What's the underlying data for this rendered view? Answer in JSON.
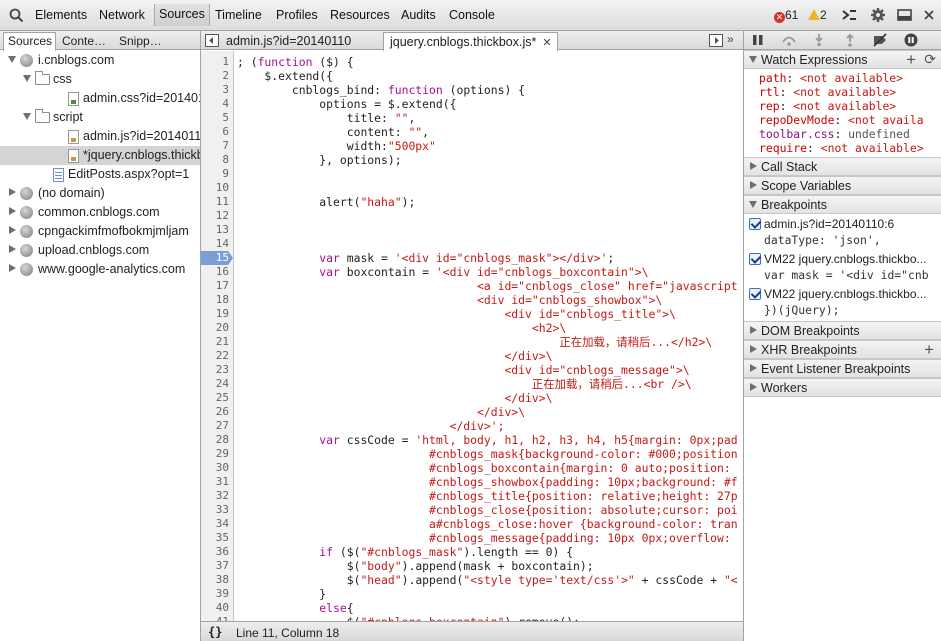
{
  "toolbar": {
    "panels": [
      "Elements",
      "Network",
      "Sources",
      "Timeline",
      "Profiles",
      "Resources",
      "Audits",
      "Console"
    ],
    "active_panel": "Sources",
    "error_count": "61",
    "warning_count": "2"
  },
  "navigator": {
    "tabs": [
      "Sources",
      "Conte…",
      "Snipp…"
    ],
    "tree": [
      {
        "label": "i.cnblogs.com",
        "level": 0,
        "type": "domain",
        "expanded": true
      },
      {
        "label": "css",
        "level": 1,
        "type": "folder",
        "expanded": true
      },
      {
        "label": "admin.css?id=20140110",
        "level": 2,
        "type": "css"
      },
      {
        "label": "script",
        "level": 1,
        "type": "folder",
        "expanded": true
      },
      {
        "label": "admin.js?id=20140110",
        "level": 2,
        "type": "js"
      },
      {
        "label": "*jquery.cnblogs.thickbox",
        "level": 2,
        "type": "js",
        "selected": true
      },
      {
        "label": "EditPosts.aspx?opt=1",
        "level": 1,
        "type": "page"
      },
      {
        "label": "(no domain)",
        "level": 0,
        "type": "domain"
      },
      {
        "label": "common.cnblogs.com",
        "level": 0,
        "type": "domain"
      },
      {
        "label": "cpngackimfmofbokmjmljam",
        "level": 0,
        "type": "domain"
      },
      {
        "label": "upload.cnblogs.com",
        "level": 0,
        "type": "domain"
      },
      {
        "label": "www.google-analytics.com",
        "level": 0,
        "type": "domain"
      }
    ]
  },
  "editor": {
    "tabs": [
      {
        "label": "admin.js?id=20140110",
        "active": false
      },
      {
        "label": "jquery.cnblogs.thickbox.js*",
        "active": true
      }
    ],
    "breakpoint_line": 15,
    "lines": [
      "; (function ($) {",
      "    $.extend({",
      "        cnblogs_bind: function (options) {",
      "            options = $.extend({",
      "                title: \"\",",
      "                content: \"\",",
      "                width:\"500px\"",
      "            }, options);",
      "",
      "",
      "            alert(\"haha\");",
      "",
      "",
      "",
      "            var mask = '<div id=\"cnblogs_mask\"></div>';",
      "            var boxcontain = '<div id=\"cnblogs_boxcontain\">\\",
      "                                   <a id=\"cnblogs_close\" href=\"javascript",
      "                                   <div id=\"cnblogs_showbox\">\\",
      "                                       <div id=\"cnblogs_title\">\\",
      "                                           <h2>\\",
      "                                               正在加载，请稍后...</h2>\\",
      "                                       </div>\\",
      "                                       <div id=\"cnblogs_message\">\\",
      "                                           正在加载，请稍后...<br />\\",
      "                                       </div>\\",
      "                                   </div>\\",
      "                               </div>';",
      "            var cssCode = 'html, body, h1, h2, h3, h4, h5{margin: 0px;pad",
      "                            #cnblogs_mask{background-color: #000;position",
      "                            #cnblogs_boxcontain{margin: 0 auto;position:",
      "                            #cnblogs_showbox{padding: 10px;background: #f",
      "                            #cnblogs_title{position: relative;height: 27p",
      "                            #cnblogs_close{position: absolute;cursor: poi",
      "                            a#cnblogs_close:hover {background-color: tran",
      "                            #cnblogs_message{padding: 10px 0px;overflow:",
      "            if ($(\"#cnblogs_mask\").length == 0) {",
      "                $(\"body\").append(mask + boxcontain);",
      "                $(\"head\").append(\"<style type='text/css'>\" + cssCode + \"<",
      "            }",
      "            else{",
      "                $(\"#cnblogs_boxcontain\").remove();"
    ],
    "status_format": "{}",
    "status_position": "Line 11, Column 18"
  },
  "sidebar": {
    "watch_title": "Watch Expressions",
    "watches": [
      {
        "name": "path",
        "value": "<not available>"
      },
      {
        "name": "rtl",
        "value": "<not available>"
      },
      {
        "name": "rep",
        "value": "<not available>"
      },
      {
        "name": "repoDevMode",
        "value": "<not availa"
      },
      {
        "name": "toolbar.css",
        "value": "undefined"
      },
      {
        "name": "require",
        "value": "<not available>"
      }
    ],
    "sections_top": [
      "Call Stack",
      "Scope Variables",
      "Breakpoints"
    ],
    "breakpoints": [
      {
        "title": "admin.js?id=20140110:6",
        "code": "dataType: 'json',"
      },
      {
        "title": "VM22 jquery.cnblogs.thickbo...",
        "code": "var mask = '<div id=\"cnb"
      },
      {
        "title": "VM22 jquery.cnblogs.thickbo...",
        "code": "})(jQuery);"
      }
    ],
    "sections_bottom": [
      "DOM Breakpoints",
      "XHR Breakpoints",
      "Event Listener Breakpoints",
      "Workers"
    ]
  },
  "colors": {
    "breakpoint_marker": "#7a9fd6",
    "keyword": "#aa0d91",
    "string": "#c41a16",
    "error_icon": "#d0332a",
    "warning_icon": "#e6b82d"
  }
}
